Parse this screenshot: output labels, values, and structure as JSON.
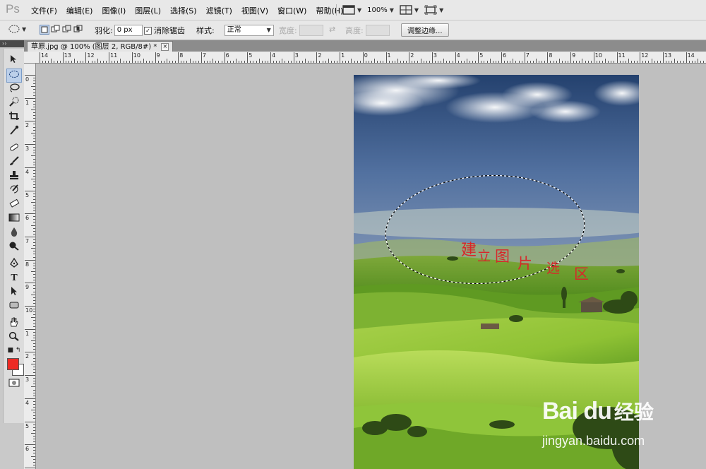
{
  "app": {
    "logo": "Ps"
  },
  "menu": [
    "文件(F)",
    "编辑(E)",
    "图像(I)",
    "图层(L)",
    "选择(S)",
    "滤镜(T)",
    "视图(V)",
    "窗口(W)",
    "帮助(H)"
  ],
  "menubar_right": {
    "zoom": "100%"
  },
  "options": {
    "feather_label": "羽化:",
    "feather_value": "0 px",
    "antialias_label": "消除锯齿",
    "antialias_checked": "✓",
    "style_label": "样式:",
    "style_value": "正常",
    "width_label": "宽度:",
    "height_label": "高度:",
    "refine_edge_button": "调整边缘..."
  },
  "document_tab": {
    "title": "草原.jpg @ 100% (图层 2, RGB/8#) *",
    "close": "×"
  },
  "ruler_h_labels": [
    "14",
    "13",
    "12",
    "11",
    "10",
    "9",
    "8",
    "7",
    "6",
    "5",
    "4",
    "3",
    "2",
    "1",
    "0",
    "1",
    "2",
    "3",
    "4",
    "5",
    "6",
    "7",
    "8",
    "9",
    "10",
    "11",
    "12",
    "13",
    "14",
    "15"
  ],
  "ruler_v_labels": [
    "0",
    "1",
    "2",
    "3",
    "4",
    "5",
    "6",
    "7",
    "8",
    "9",
    "10",
    "1",
    "2",
    "3",
    "4",
    "5",
    "6",
    "7"
  ],
  "annotation": {
    "chars": [
      "建",
      "立",
      "图",
      "片",
      "选",
      "区"
    ]
  },
  "watermark": {
    "logo_text": "Bai du",
    "logo_cn": "经验",
    "url": "jingyan.baidu.com"
  },
  "colors": {
    "foreground": "#ee2a24",
    "background": "#ffffff",
    "annotation": "#d8262a"
  },
  "icons": [
    "move-tool-icon",
    "elliptical-marquee-tool-icon",
    "lasso-tool-icon",
    "quick-selection-tool-icon",
    "crop-tool-icon",
    "eyedropper-tool-icon",
    "spot-healing-brush-icon",
    "brush-tool-icon",
    "clone-stamp-icon",
    "history-brush-icon",
    "eraser-tool-icon",
    "gradient-tool-icon",
    "blur-tool-icon",
    "dodge-tool-icon",
    "pen-tool-icon",
    "type-tool-icon",
    "path-selection-icon",
    "rectangle-tool-icon",
    "hand-tool-icon",
    "zoom-tool-icon"
  ]
}
